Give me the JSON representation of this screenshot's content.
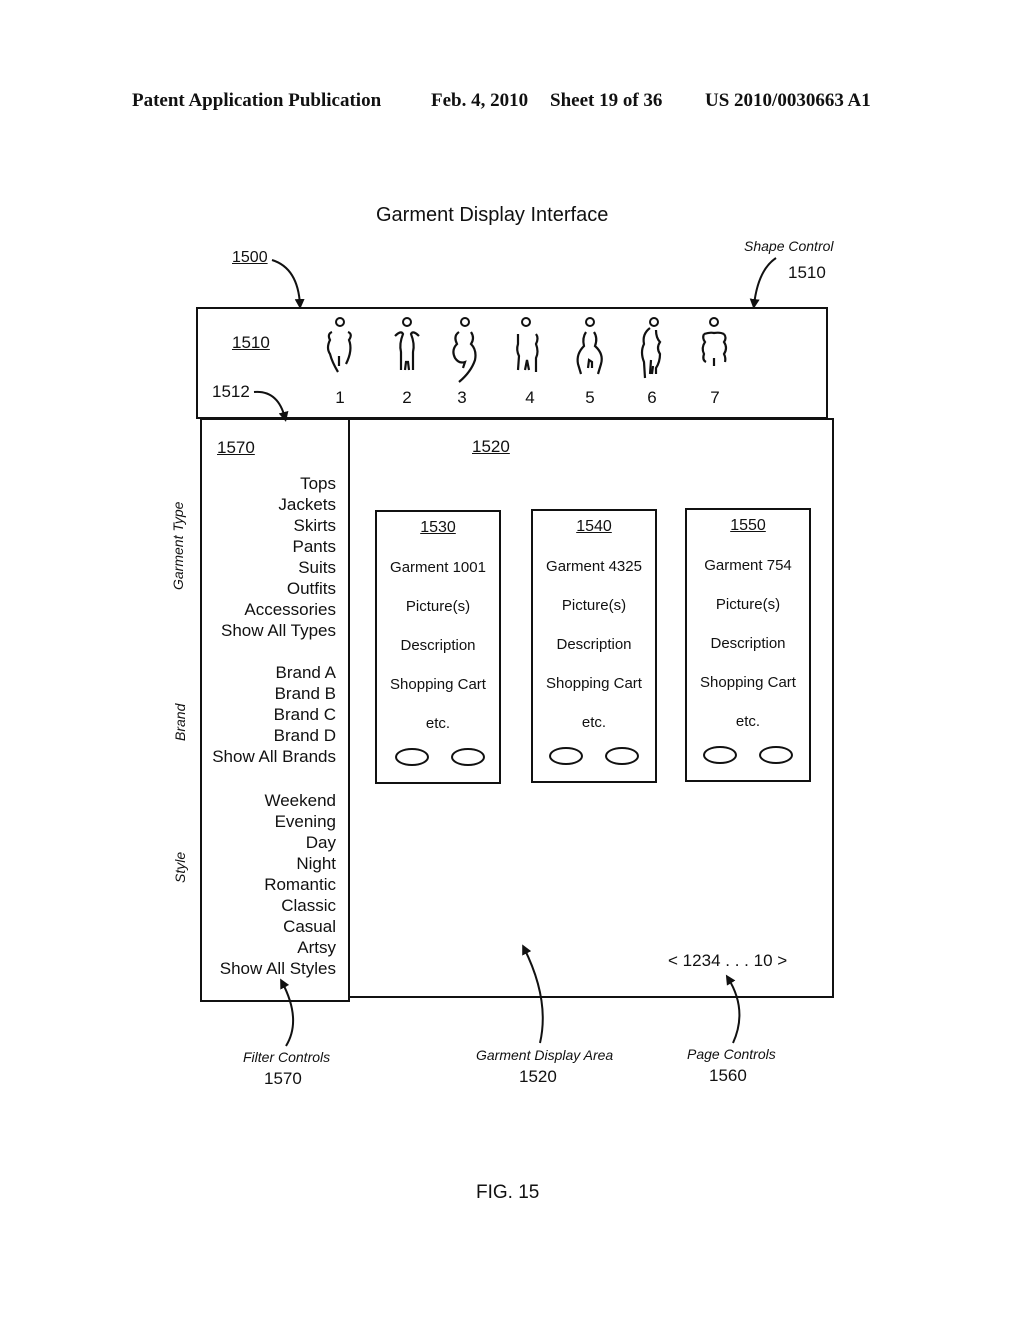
{
  "header": {
    "left": "Patent Application Publication",
    "date": "Feb. 4, 2010",
    "sheet": "Sheet 19 of 36",
    "pub_number": "US 2010/0030663 A1"
  },
  "figure": {
    "title": "Garment Display Interface",
    "ref_interface": "1500",
    "caption": "FIG. 15"
  },
  "shape_control": {
    "callout_label": "Shape Control",
    "callout_ref": "1510",
    "panel_ref": "1510",
    "selector_ref": "1512",
    "shapes": [
      {
        "number": "1",
        "icon": "body-shape-1-icon"
      },
      {
        "number": "2",
        "icon": "body-shape-2-icon"
      },
      {
        "number": "3",
        "icon": "body-shape-3-icon"
      },
      {
        "number": "4",
        "icon": "body-shape-4-icon"
      },
      {
        "number": "5",
        "icon": "body-shape-5-icon"
      },
      {
        "number": "6",
        "icon": "body-shape-6-icon"
      },
      {
        "number": "7",
        "icon": "body-shape-7-icon"
      }
    ]
  },
  "filters": {
    "ref": "1570",
    "callout_label": "Filter Controls",
    "callout_ref": "1570",
    "groups": [
      {
        "label": "Garment Type",
        "items": [
          "Tops",
          "Jackets",
          "Skirts",
          "Pants",
          "Suits",
          "Outfits",
          "Accessories",
          "Show All Types"
        ]
      },
      {
        "label": "Brand",
        "items": [
          "Brand A",
          "Brand B",
          "Brand C",
          "Brand D",
          "Show All Brands"
        ]
      },
      {
        "label": "Style",
        "items": [
          "Weekend",
          "Evening",
          "Day",
          "Night",
          "Romantic",
          "Classic",
          "Casual",
          "Artsy",
          "Show All Styles"
        ]
      }
    ]
  },
  "display_area": {
    "ref": "1520",
    "callout_label": "Garment Display Area",
    "callout_ref": "1520",
    "cards": [
      {
        "ref": "1530",
        "name": "Garment 1001",
        "picture": "Picture(s)",
        "description": "Description",
        "cart": "Shopping Cart",
        "etc": "etc."
      },
      {
        "ref": "1540",
        "name": "Garment 4325",
        "picture": "Picture(s)",
        "description": "Description",
        "cart": "Shopping Cart",
        "etc": "etc."
      },
      {
        "ref": "1550",
        "name": "Garment 754",
        "picture": "Picture(s)",
        "description": "Description",
        "cart": "Shopping Cart",
        "etc": "etc."
      }
    ]
  },
  "pagination": {
    "prev": "<",
    "pages": [
      "1",
      "2",
      "3",
      "4"
    ],
    "ellipsis": ". . .",
    "last": "10",
    "next": ">",
    "callout_label": "Page Controls",
    "callout_ref": "1560"
  }
}
